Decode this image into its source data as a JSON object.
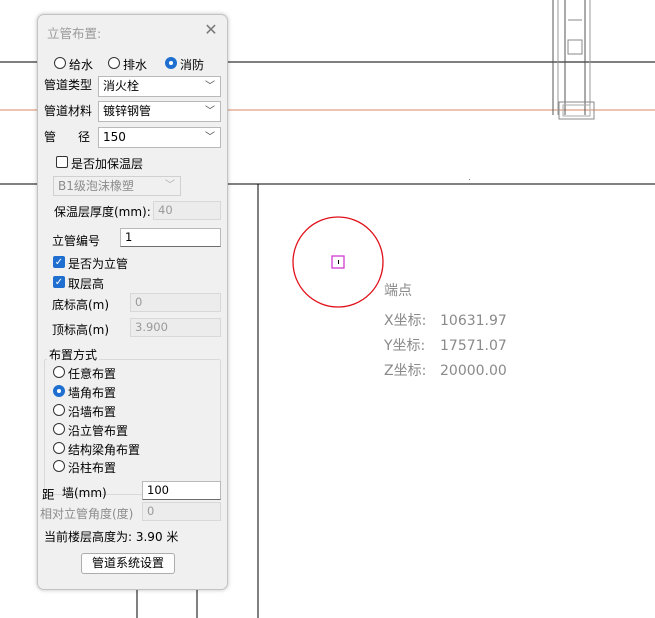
{
  "dialog": {
    "title": "立管布置:",
    "pipe_system": {
      "options": [
        "给水",
        "排水",
        "消防"
      ],
      "selected": "消防"
    },
    "pipe_type": {
      "label": "管道类型",
      "value": "消火栓"
    },
    "pipe_material": {
      "label": "管道材料",
      "value": "镀锌钢管"
    },
    "diameter": {
      "label_left": "管",
      "label_right": "径",
      "value": "150"
    },
    "insulation": {
      "checkbox_label": "是否加保温层",
      "checked": false,
      "material_value": "B1级泡沫橡塑",
      "thickness_label": "保温层厚度(mm):",
      "thickness_value": "40"
    },
    "riser_number": {
      "label": "立管编号",
      "value": "1"
    },
    "is_riser": {
      "label": "是否为立管",
      "checked": true
    },
    "use_floor_height": {
      "label": "取层高",
      "checked": true
    },
    "bottom_elevation": {
      "label": "底标高(m)",
      "value": "0"
    },
    "top_elevation": {
      "label": "顶标高(m)",
      "value": "3.900"
    },
    "layout_mode": {
      "title": "布置方式",
      "options": [
        "任意布置",
        "墙角布置",
        "沿墙布置",
        "沿立管布置",
        "结构梁角布置",
        "沿柱布置"
      ],
      "selected": "墙角布置"
    },
    "wall_distance": {
      "label_left": "距",
      "label_right": "墙(mm)",
      "value": "100"
    },
    "relative_angle": {
      "label": "相对立管角度(度)",
      "value": "0"
    },
    "floor_height_text": "当前楼层高度为: 3.90 米",
    "settings_button": "管道系统设置"
  },
  "snap_info": {
    "title": "端点",
    "x_label": "X坐标:",
    "x_value": "10631.97",
    "y_label": "Y坐标:",
    "y_value": "17571.07",
    "z_label": "Z坐标:",
    "z_value": "20000.00"
  },
  "colors": {
    "circle": "#e0101a",
    "marker": "#d23bd2",
    "radio_accent": "#1f6fd0",
    "cad_line": "#000000",
    "orange_line": "#d98a63"
  }
}
